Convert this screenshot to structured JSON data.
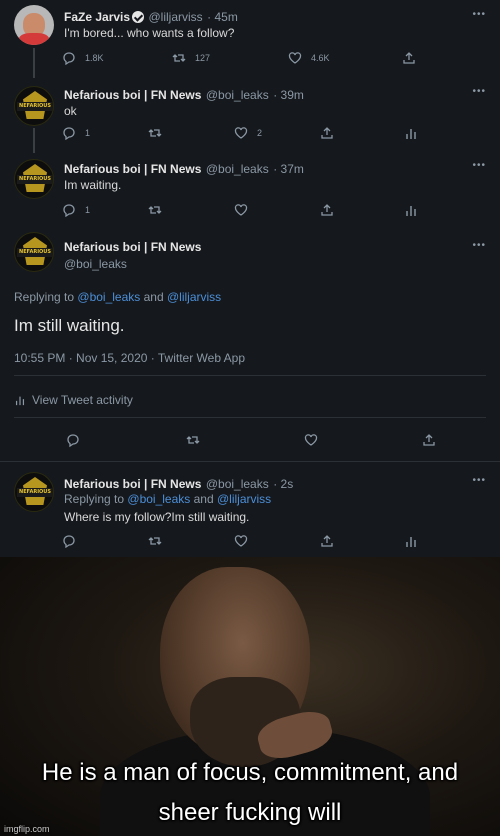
{
  "tweets": {
    "t1": {
      "name": "FaZe Jarvis",
      "handle": "@liljarviss",
      "time": "· 45m",
      "text": "I'm bored... who wants a follow?",
      "replies": "1.8K",
      "retweets": "127",
      "likes": "4.6K"
    },
    "t2": {
      "name": "Nefarious boi | FN News",
      "handle": "@boi_leaks",
      "time": "· 39m",
      "text": "ok",
      "replies": "1",
      "likes": "2"
    },
    "t3": {
      "name": "Nefarious boi | FN News",
      "handle": "@boi_leaks",
      "time": "· 37m",
      "text": "Im waiting.",
      "replies": "1"
    },
    "main": {
      "name": "Nefarious boi | FN News",
      "handle": "@boi_leaks",
      "replying_prefix": "Replying to",
      "replying_user1": "@boi_leaks",
      "replying_and": "and",
      "replying_user2": "@liljarviss",
      "text": "Im still waiting.",
      "timestamp": "10:55 PM · Nov 15, 2020 · Twitter Web App",
      "activity": "View Tweet activity"
    },
    "t5": {
      "name": "Nefarious boi | FN News",
      "handle": "@boi_leaks",
      "time": "· 2s",
      "replying_prefix": "Replying to",
      "replying_user1": "@boi_leaks",
      "replying_and": "and",
      "replying_user2": "@liljarviss",
      "text": "Where is my follow?Im still waiting."
    }
  },
  "avatar_tag": "NEFARIOUS",
  "meme": {
    "caption_line1": "He is a man of focus, commitment, and",
    "caption_line2": "sheer fucking will",
    "watermark": "imgflip.com"
  },
  "more_label": "•••"
}
